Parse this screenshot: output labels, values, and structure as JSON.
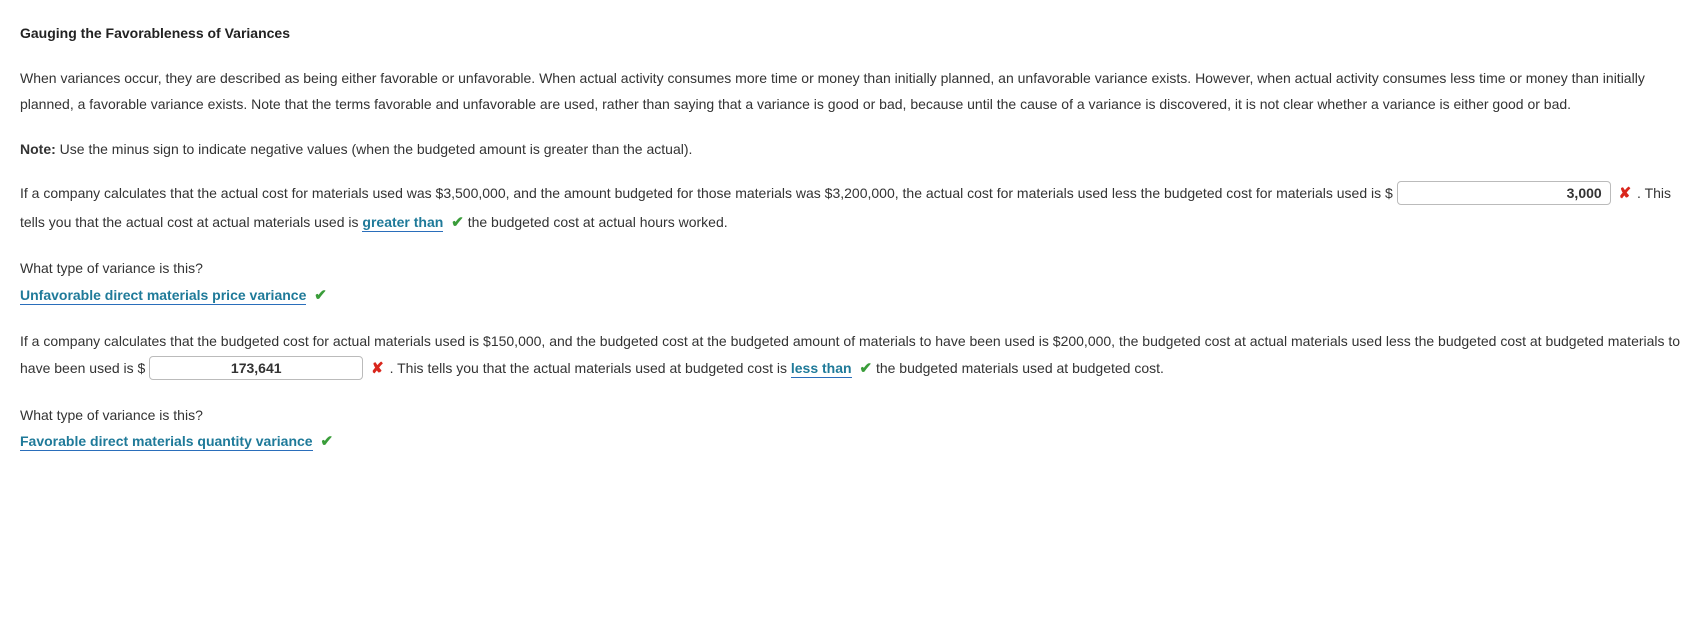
{
  "heading": "Gauging the Favorableness of Variances",
  "intro": "When variances occur, they are described as being either favorable or unfavorable. When actual activity consumes more time or money than initially planned, an unfavorable variance exists. However, when actual activity consumes less time or money than initially planned, a favorable variance exists. Note that the terms favorable and unfavorable are used, rather than saying that a variance is good or bad, because until the cause of a variance is discovered, it is not clear whether a variance is either good or bad.",
  "note_label": "Note:",
  "note_text": " Use the minus sign to indicate negative values (when the budgeted amount is greater than the actual).",
  "q1": {
    "part1": "If a company calculates that the actual cost for materials used was $3,500,000, and the amount budgeted for those materials was $3,200,000, the actual cost for materials used less the budgeted cost for materials used is $",
    "input_value": "3,000",
    "part2": " . This tells you that the actual cost at actual materials used is ",
    "dropdown": "greater than",
    "part3": " the budgeted cost at actual hours worked."
  },
  "type_question": "What type of variance is this?",
  "q1_type_answer": "Unfavorable direct materials price variance",
  "q2": {
    "part1": "If a company calculates that the budgeted cost for actual materials used is $150,000, and the budgeted cost at the budgeted amount of materials to have been used is $200,000, the budgeted cost at actual materials used less the budgeted cost at budgeted materials to have been used is $ ",
    "input_value": "173,641",
    "part2": " . This tells you that the actual materials used at budgeted cost is ",
    "dropdown": "less than",
    "part3": " the budgeted materials used at budgeted cost."
  },
  "q2_type_answer": "Favorable direct materials quantity variance",
  "icons": {
    "x": "✘",
    "check": "✔"
  }
}
